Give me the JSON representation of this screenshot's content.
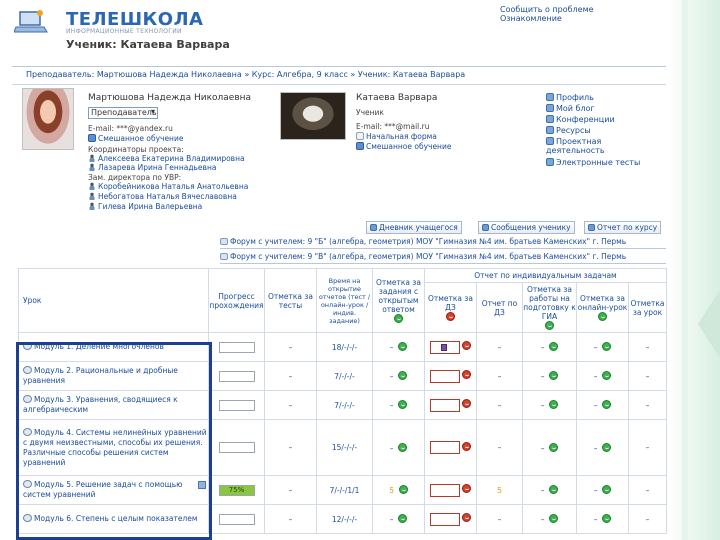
{
  "header": {
    "logo_text": "ТЕЛЕШКОЛА",
    "logo_sub": "ИНФОРМАЦИОННЫЕ ТЕХНОЛОГИИ",
    "top_links": [
      "Сообщить о проблеме",
      "Ознакомление"
    ],
    "student_title": "Ученик: Катаева Варвара"
  },
  "breadcrumb": "Преподаватель: Мартюшова Надежда Николаевна » Курс: Алгебра, 9 класс » Ученик: Катаева Варвара",
  "teacher": {
    "name": "Мартюшова Надежда Николаевна",
    "role_select": "Преподаватель",
    "email": "E-mail: ***@yandex.ru",
    "course_link": "Смешанное обучение",
    "coordinators_label": "Координаторы проекта:",
    "coordinators": [
      "Алексеева Екатерина Владимировна",
      "Лазарева Ирина Геннадьевна"
    ],
    "deputy_label": "Зам. директора по УВР:",
    "deputies": [
      "Коробейникова Наталья Анатольевна",
      "Небогатова Наталья Вячеславовна",
      "Гилева Ирина Валерьевна"
    ]
  },
  "student": {
    "name": "Катаева Варвара",
    "role": "Ученик",
    "email": "E-mail: ***@mail.ru",
    "portfolio_link": "Начальная форма",
    "course_link": "Смешанное обучение"
  },
  "right_menu": [
    "Профиль",
    "Мой блог",
    "Конференции",
    "Ресурсы",
    "Проектная деятельность",
    "Электронные тесты"
  ],
  "tabs": [
    "Дневник учащегося",
    "Сообщения ученику",
    "Отчет по курсу"
  ],
  "forums": [
    "Форум с учителем: 9 \"Б\" (алгебра, геометрия) МОУ \"Гимназия №4 им. братьев Каменских\" г. Пермь",
    "Форум с учителем: 9 \"В\" (алгебра, геометрия) МОУ \"Гимназия №4 им. братьев Каменских\" г. Пермь"
  ],
  "table": {
    "group_header": "Отчет по индивидуальным задачам",
    "headers": {
      "lesson": "Урок",
      "progress": "Прогресс прохождения",
      "tests_mark": "Отметка за тесты",
      "time_spent": "Время на открытие отчетов (тест / онлайн-урок / индив. задание)",
      "open_mark": "Отметка за задания с открытым ответом",
      "hw_mark": "Отметка за ДЗ",
      "dz_reserved": "Отчет по ДЗ",
      "prep_mark": "Отметка за работы на подготовку к ГИА",
      "online_mark": "Отметка за онлайн-урок",
      "lesson_mark": "Отметка за урок"
    },
    "rows": [
      {
        "module": "Модуль 1. Деление многочленов",
        "progress": "",
        "tests": "–",
        "time": "18/-/-/-",
        "open": "–",
        "hw": "–",
        "dz": "–",
        "prep": "–",
        "online": "–",
        "lesson": "–"
      },
      {
        "module": "Модуль 2. Рациональные и дробные уравнения",
        "progress": "",
        "tests": "–",
        "time": "7/-/-/-",
        "open": "–",
        "hw": "–",
        "dz": "–",
        "prep": "–",
        "online": "–",
        "lesson": "–"
      },
      {
        "module": "Модуль 3. Уравнения, сводящиеся к алгебраическим",
        "progress": "",
        "tests": "–",
        "time": "7/-/-/-",
        "open": "–",
        "hw": "–",
        "dz": "–",
        "prep": "–",
        "online": "–",
        "lesson": "–"
      },
      {
        "module": "Модуль 4. Системы нелинейных уравнений с двумя неизвестными, способы их решения. Различные способы решения систем уравнений",
        "progress": "",
        "tests": "–",
        "time": "15/-/-/-",
        "open": "–",
        "hw": "–",
        "dz": "–",
        "prep": "–",
        "online": "–",
        "lesson": "–"
      },
      {
        "module": "Модуль 5. Решение задач с помощью систем уравнений",
        "progress": "75%",
        "tests": "–",
        "time": "7/-/-/1/1",
        "open": "5",
        "hw": "–",
        "dz": "5",
        "prep": "–",
        "online": "–",
        "lesson": "–"
      },
      {
        "module": "Модуль 6. Степень с целым показателем",
        "progress": "",
        "tests": "–",
        "time": "12/-/-/-",
        "open": "–",
        "hw": "–",
        "dz": "–",
        "prep": "–",
        "online": "–",
        "lesson": "–"
      }
    ]
  },
  "colors": {
    "accent": "#2c67b3",
    "link": "#1a4d99",
    "highlight": "#1c3f8f",
    "smile_good": "#39b34a",
    "smile_bad": "#d8402a",
    "progress_fill": "#8cc63f"
  }
}
